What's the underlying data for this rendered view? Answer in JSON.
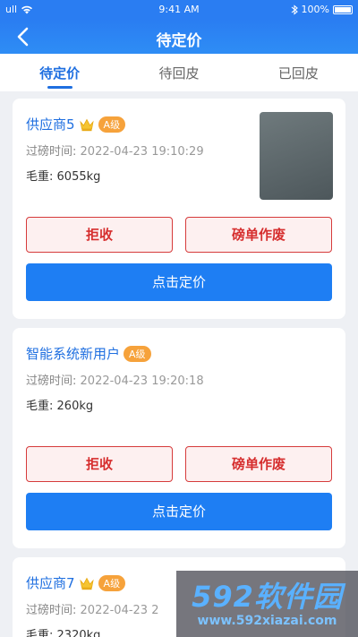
{
  "status_bar": {
    "carrier": "ull",
    "time": "9:41 AM",
    "battery": "100%"
  },
  "nav": {
    "title": "待定价"
  },
  "tabs": [
    {
      "label": "待定价",
      "active": true
    },
    {
      "label": "待回皮",
      "active": false
    },
    {
      "label": "已回皮",
      "active": false
    }
  ],
  "cards": [
    {
      "supplier": "供应商5",
      "grade": "A级",
      "weigh_time_label": "过磅时间:",
      "weigh_time": "2022-04-23 19:10:29",
      "gross_label": "毛重:",
      "gross": "6055kg",
      "reject_label": "拒收",
      "void_label": "磅单作废",
      "price_label": "点击定价"
    },
    {
      "supplier": "智能系统新用户",
      "grade": "A级",
      "weigh_time_label": "过磅时间:",
      "weigh_time": "2022-04-23 19:20:18",
      "gross_label": "毛重:",
      "gross": "260kg",
      "reject_label": "拒收",
      "void_label": "磅单作废",
      "price_label": "点击定价"
    },
    {
      "supplier": "供应商7",
      "grade": "A级",
      "weigh_time_label": "过磅时间:",
      "weigh_time": "2022-04-23 2",
      "gross_label": "毛重:",
      "gross": "2320kg"
    }
  ],
  "watermark": {
    "logo": "592软件园",
    "url": "www.592xiazai.com"
  },
  "colors": {
    "primary": "#1e7ef3",
    "danger": "#d62e2e",
    "grade": "#f6a23b"
  }
}
